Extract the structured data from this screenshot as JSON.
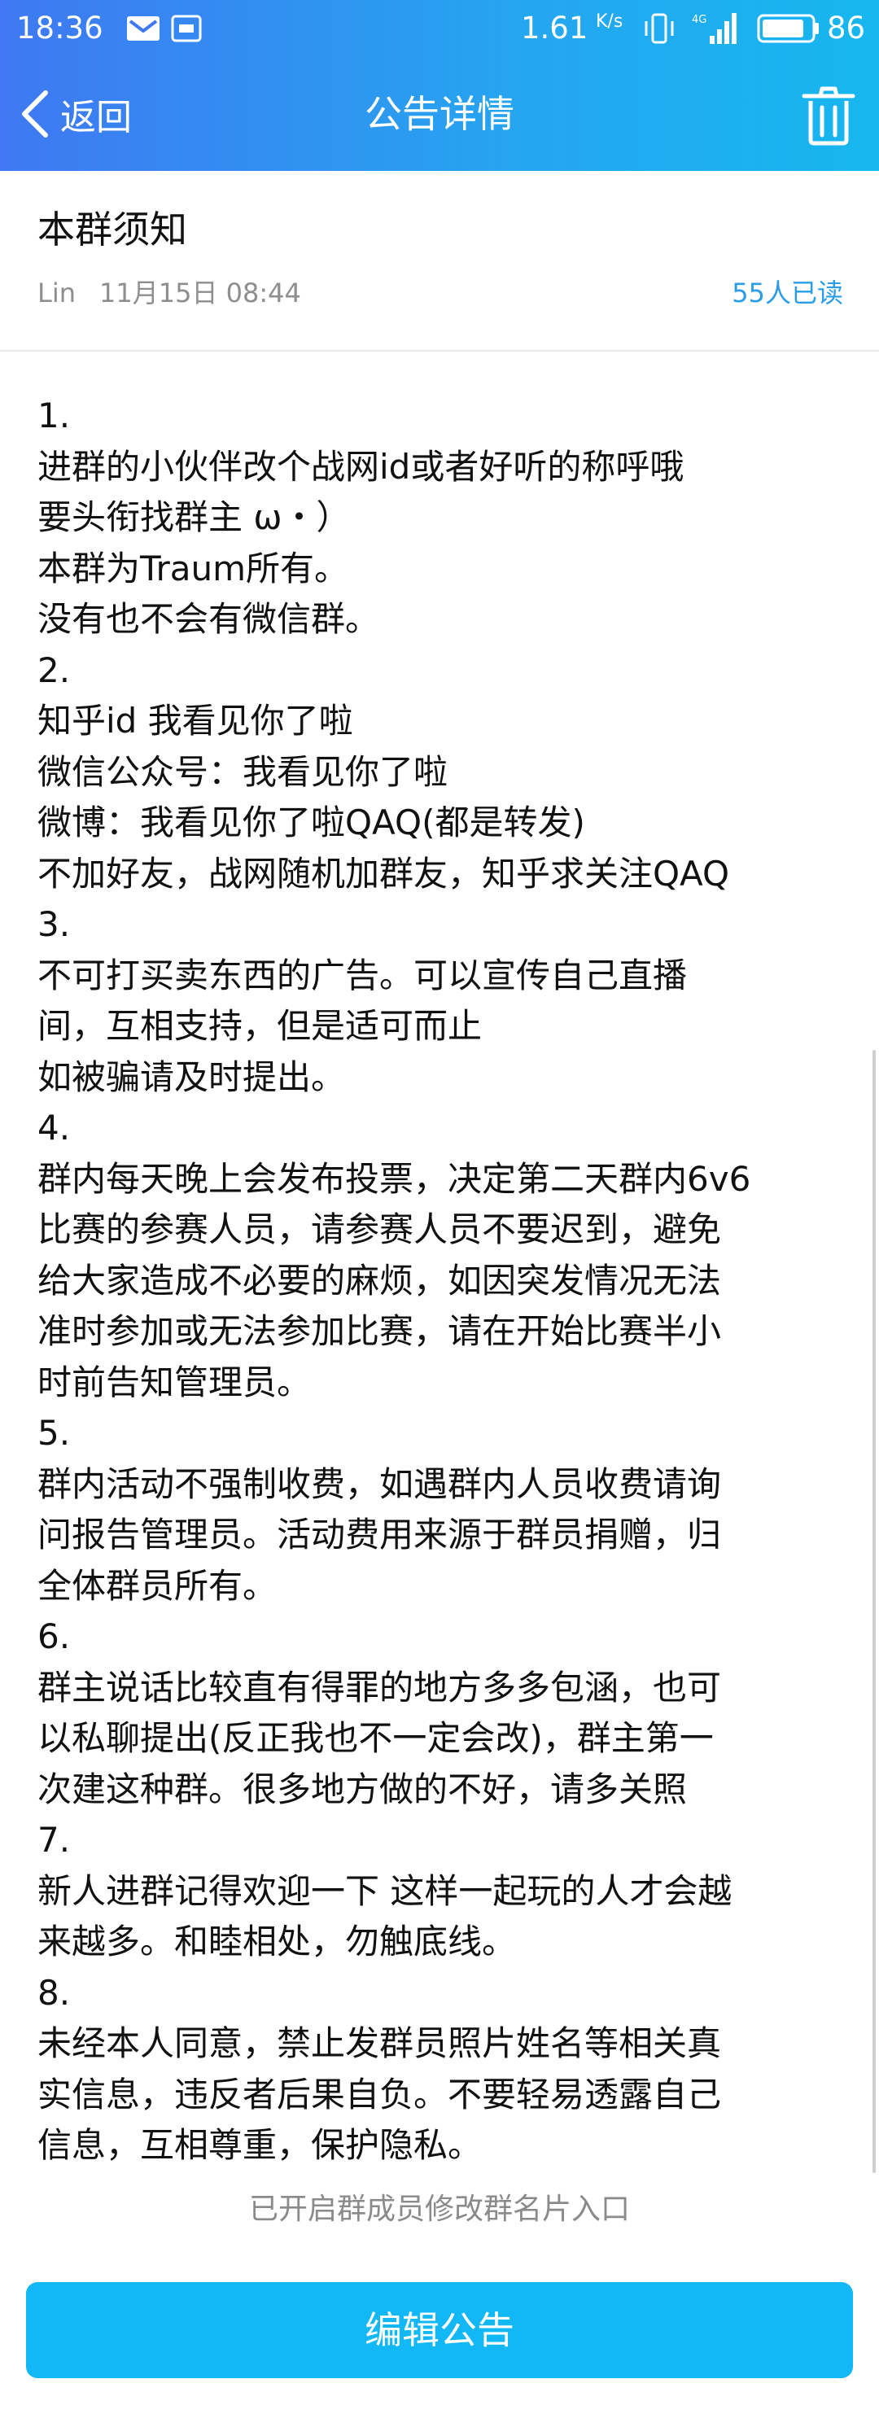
{
  "status_bar": {
    "time": "18:36",
    "speed": "1.61",
    "speed_unit": "K/s",
    "signal": "4G",
    "battery": "86"
  },
  "nav": {
    "back_label": "返回",
    "title": "公告详情"
  },
  "announcement": {
    "title": "本群须知",
    "author": "Lin",
    "date": "11月15日 08:44",
    "read_count": "55人已读",
    "lines": [
      "1.",
      "进群的小伙伴改个战网id或者好听的称呼哦",
      "要头衔找群主 ω・）",
      "本群为Traum所有。",
      "没有也不会有微信群。",
      "2.",
      "知乎id 我看见你了啦",
      "微信公众号：我看见你了啦",
      "微博：我看见你了啦QAQ(都是转发)",
      "不加好友，战网随机加群友，知乎求关注QAQ",
      "3.",
      "不可打买卖东西的广告。可以宣传自己直播",
      "间，互相支持，但是适可而止",
      "如被骗请及时提出。",
      "4.",
      "群内每天晚上会发布投票，决定第二天群内6v6",
      "比赛的参赛人员，请参赛人员不要迟到，避免",
      "给大家造成不必要的麻烦，如因突发情况无法",
      "准时参加或无法参加比赛，请在开始比赛半小",
      "时前告知管理员。",
      "5.",
      "群内活动不强制收费，如遇群内人员收费请询",
      "问报告管理员。活动费用来源于群员捐赠，归",
      "全体群员所有。",
      "6.",
      "群主说话比较直有得罪的地方多多包涵，也可",
      "以私聊提出(反正我也不一定会改)，群主第一",
      "次建这种群。很多地方做的不好，请多关照",
      "7.",
      "新人进群记得欢迎一下 这样一起玩的人才会越",
      "来越多。和睦相处，勿触底线。",
      "8.",
      "未经本人同意，禁止发群员照片姓名等相关真",
      "实信息，违反者后果自负。不要轻易透露自己",
      "信息，互相尊重，保护隐私。"
    ]
  },
  "footer": {
    "member_edit_note": "已开启群成员修改群名片入口",
    "edit_button": "编辑公告"
  }
}
